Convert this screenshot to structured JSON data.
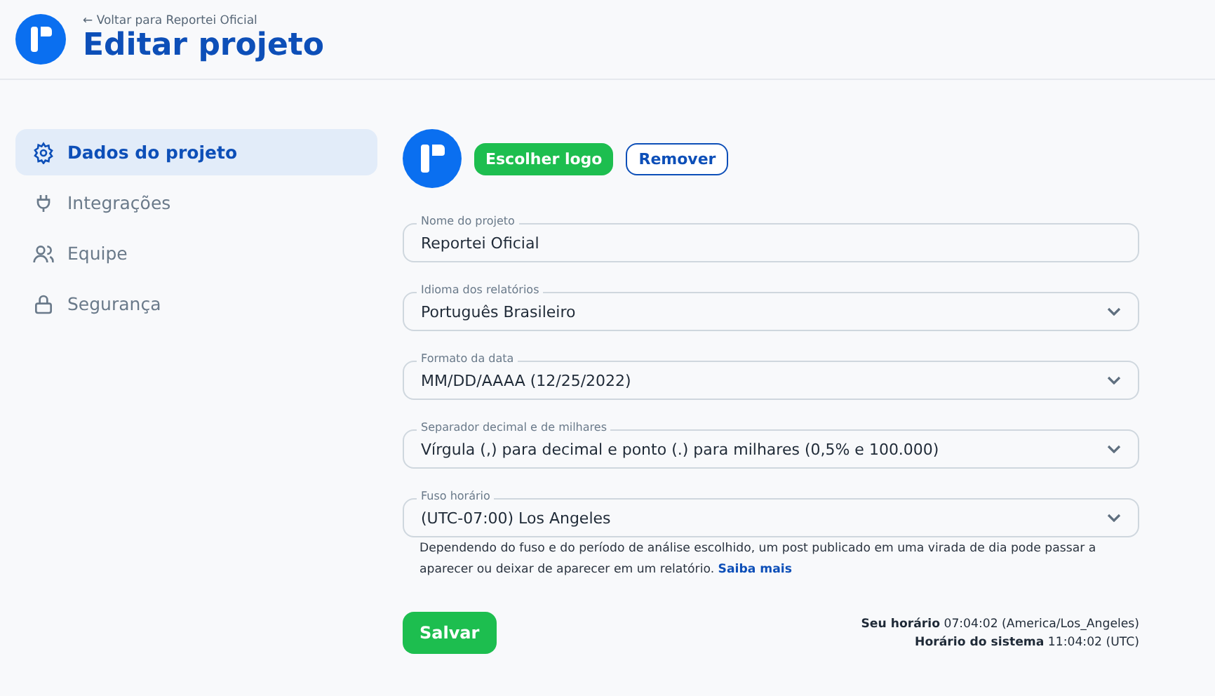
{
  "header": {
    "back_link": "← Voltar para Reportei Oficial",
    "title": "Editar projeto"
  },
  "sidebar": {
    "items": [
      {
        "label": "Dados do projeto",
        "selected": true
      },
      {
        "label": "Integrações",
        "selected": false
      },
      {
        "label": "Equipe",
        "selected": false
      },
      {
        "label": "Segurança",
        "selected": false
      }
    ]
  },
  "logo_actions": {
    "choose": "Escolher logo",
    "remove": "Remover"
  },
  "fields": [
    {
      "kind": "text",
      "label": "Nome do projeto",
      "value": "Reportei Oficial"
    },
    {
      "kind": "select",
      "label": "Idioma dos relatórios",
      "value": "Português Brasileiro"
    },
    {
      "kind": "select",
      "label": "Formato da data",
      "value": "MM/DD/AAAA (12/25/2022)"
    },
    {
      "kind": "select",
      "label": "Separador decimal e de milhares",
      "value": "Vírgula (,) para decimal e ponto (.) para milhares (0,5% e 100.000)"
    },
    {
      "kind": "select",
      "label": "Fuso horário",
      "value": "(UTC-07:00) Los Angeles"
    }
  ],
  "note": {
    "text": "Dependendo do fuso e do período de análise escolhido, um post publicado em uma virada de dia pode passar a aparecer ou deixar de aparecer em um relatório.",
    "link": "Saiba mais"
  },
  "save_button": "Salvar",
  "times": [
    "**Seu horário** 07:04:02 (America/Los_Angeles)",
    "**Horário do sistema** 11:04:02 (UTC)"
  ]
}
